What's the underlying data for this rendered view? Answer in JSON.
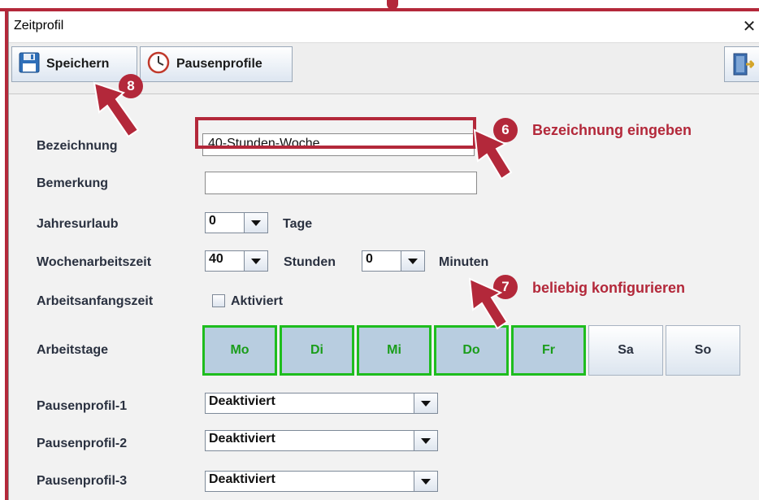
{
  "window": {
    "title": "Zeitprofil",
    "close_glyph": "✕"
  },
  "toolbar": {
    "save_label": "Speichern",
    "pause_profiles_label": "Pausenprofile",
    "save_icon": "floppy-disk-icon",
    "pause_icon": "clock-icon",
    "right_icon": "door-exit-icon"
  },
  "form": {
    "bezeichnung": {
      "label": "Bezeichnung",
      "value": "40-Stunden-Woche"
    },
    "bemerkung": {
      "label": "Bemerkung",
      "value": ""
    },
    "jahresurlaub": {
      "label": "Jahresurlaub",
      "value": "0",
      "unit": "Tage"
    },
    "wochenarbeitszeit": {
      "label": "Wochenarbeitszeit",
      "hours": "40",
      "hours_unit": "Stunden",
      "minutes": "0",
      "minutes_unit": "Minuten"
    },
    "arbeitsanfangszeit": {
      "label": "Arbeitsanfangszeit",
      "checkbox_label": "Aktiviert",
      "checked": false
    },
    "arbeitstage": {
      "label": "Arbeitstage",
      "days": [
        {
          "label": "Mo",
          "active": true
        },
        {
          "label": "Di",
          "active": true
        },
        {
          "label": "Mi",
          "active": true
        },
        {
          "label": "Do",
          "active": true
        },
        {
          "label": "Fr",
          "active": true
        },
        {
          "label": "Sa",
          "active": false
        },
        {
          "label": "So",
          "active": false
        }
      ]
    },
    "pausenprofile": [
      {
        "label": "Pausenprofil-1",
        "value": "Deaktiviert"
      },
      {
        "label": "Pausenprofil-2",
        "value": "Deaktiviert"
      },
      {
        "label": "Pausenprofil-3",
        "value": "Deaktiviert"
      }
    ]
  },
  "annotations": [
    {
      "number": "6",
      "text": "Bezeichnung eingeben"
    },
    {
      "number": "7",
      "text": "beliebig konfigurieren"
    },
    {
      "number": "8",
      "text": ""
    }
  ],
  "colors": {
    "annotation": "#b3283a",
    "active_day_border": "#1ebd1e",
    "active_day_bg": "#b8cde0"
  }
}
